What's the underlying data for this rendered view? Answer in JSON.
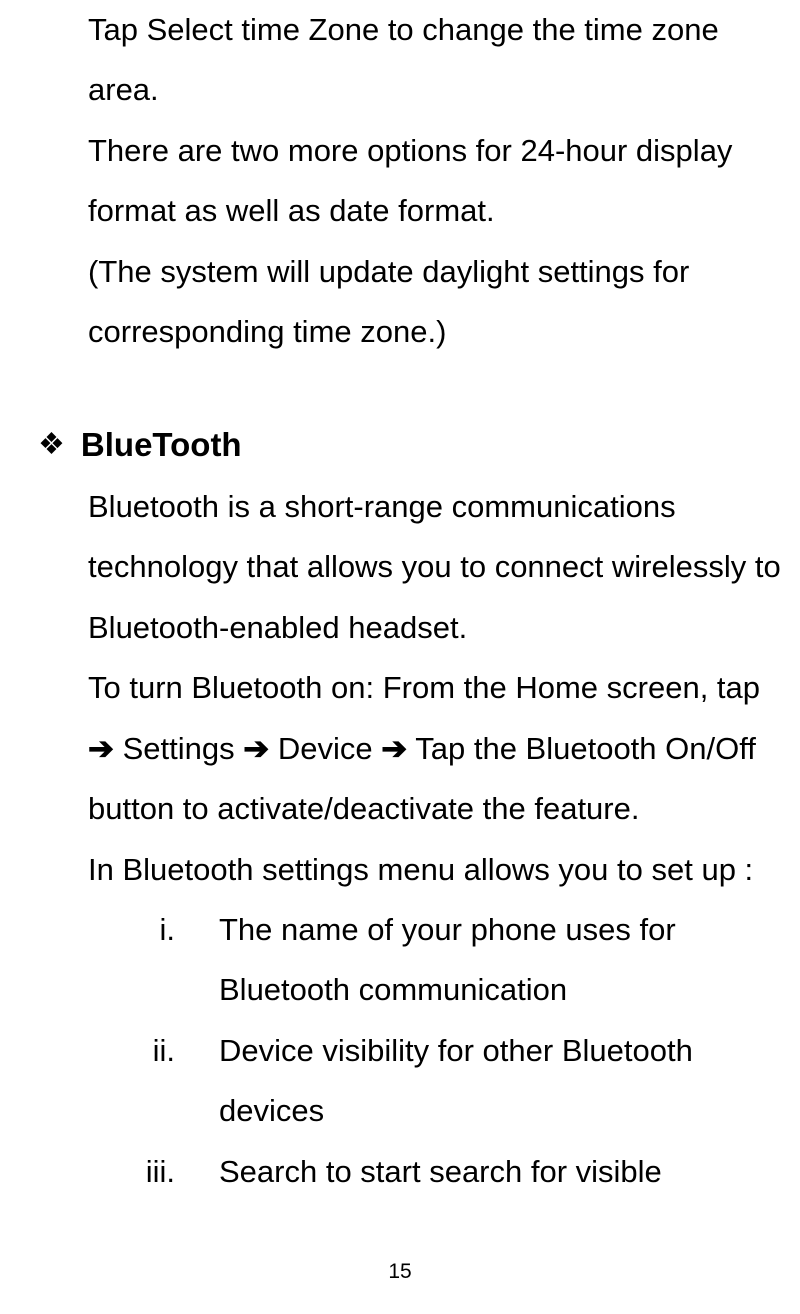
{
  "para1": "Tap Select time Zone to change the time zone area.",
  "para2": "There are two more options for 24-hour display format as well as date format.",
  "para3": "(The system will update daylight settings for corresponding time zone.)",
  "heading": "BlueTooth",
  "para4": "Bluetooth is a short-range communications technology that allows you to connect wirelessly to Bluetooth-enabled headset.",
  "para5_prefix": "To turn Bluetooth on:    From the Home screen, tap ",
  "arrow": "➔",
  "para5_seg1": " Settings ",
  "para5_seg2": " Device ",
  "para5_seg3": " Tap the Bluetooth On/Off button to activate/deactivate the feature.",
  "para6": "In Bluetooth settings menu allows you to set up :",
  "list": [
    {
      "num": "i.",
      "text": "The name of your phone uses for Bluetooth communication"
    },
    {
      "num": "ii.",
      "text": "Device visibility for other Bluetooth devices"
    },
    {
      "num": "iii.",
      "text": "Search to start search for visible"
    }
  ],
  "page_number": "15"
}
